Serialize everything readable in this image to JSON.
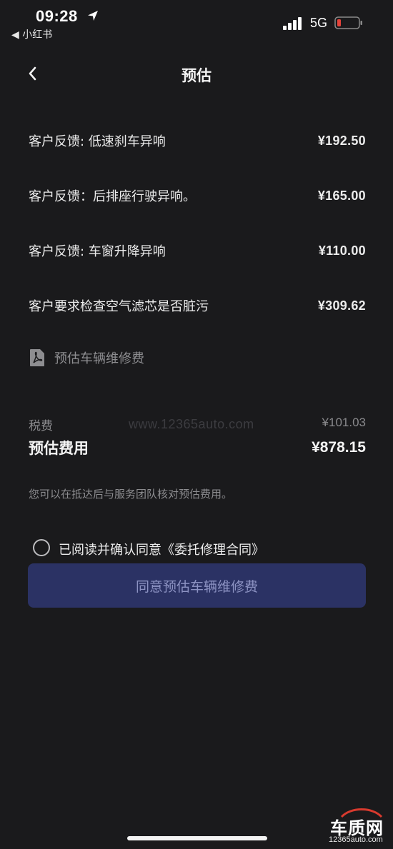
{
  "status": {
    "time": "09:28",
    "back_app": "◀ 小红书",
    "network": "5G",
    "battery_color": "#e5433a"
  },
  "nav": {
    "title": "预估",
    "back_icon": "chevron-left-icon"
  },
  "items": [
    {
      "label": "客户反馈: 低速刹车异响",
      "price": "¥192.50"
    },
    {
      "label": "客户反馈：后排座行驶异响。",
      "price": "¥165.00"
    },
    {
      "label": "客户反馈: 车窗升降异响",
      "price": "¥110.00"
    },
    {
      "label": "客户要求检查空气滤芯是否脏污",
      "price": "¥309.62"
    }
  ],
  "pdf": {
    "label": "预估车辆维修费",
    "icon": "pdf-icon"
  },
  "tax": {
    "label": "税费",
    "value": "¥101.03"
  },
  "total": {
    "label": "预估费用",
    "value": "¥878.15"
  },
  "watermark": "www.12365auto.com",
  "note": "您可以在抵达后与服务团队核对预估费用。",
  "agreement": {
    "text": "已阅读并确认同意《委托修理合同》",
    "checked": false
  },
  "button": {
    "label": "同意预估车辆维修费",
    "bg": "#2b3264"
  },
  "logo": {
    "main": "车质网",
    "sub": "12365auto.com"
  }
}
